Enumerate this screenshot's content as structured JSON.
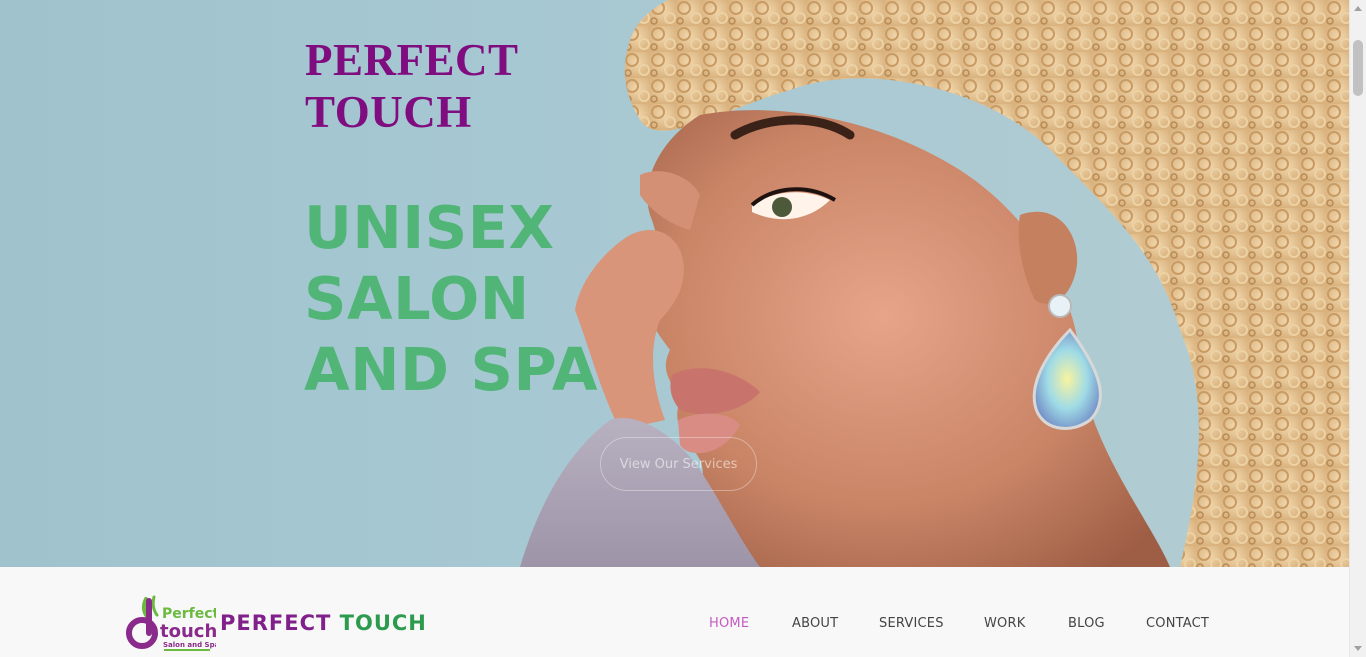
{
  "hero": {
    "brand_line1": "PERFECT",
    "brand_line2": "TOUCH",
    "tagline_line1": "UNISEX",
    "tagline_line2": "SALON",
    "tagline_line3": "AND SPA",
    "cta_label": "View Our Services"
  },
  "logo": {
    "mark_line1": "Perfect",
    "mark_line2": "touch",
    "mark_line3": "Salon and Spa",
    "name_part1": "PERFECT",
    "name_part2": "TOUCH"
  },
  "nav": {
    "items": [
      {
        "label": "HOME",
        "active": true
      },
      {
        "label": "ABOUT",
        "active": false
      },
      {
        "label": "SERVICES",
        "active": false
      },
      {
        "label": "WORK",
        "active": false
      },
      {
        "label": "BLOG",
        "active": false
      },
      {
        "label": "CONTACT",
        "active": false
      }
    ]
  },
  "colors": {
    "brand_purple": "#7f0d80",
    "brand_green": "#52b578",
    "nav_active": "#c55bc1",
    "hero_bg": "#a5c7d1"
  }
}
